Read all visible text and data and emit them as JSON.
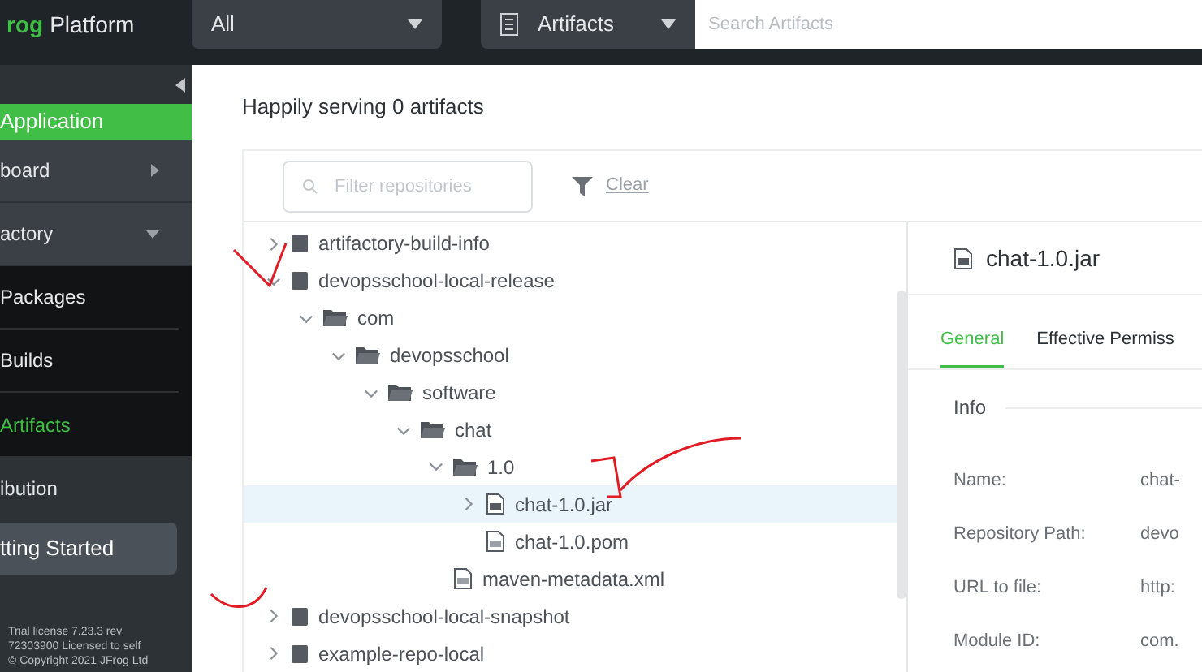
{
  "brand": {
    "logo": "rog",
    "name": "Platform"
  },
  "top_bar": {
    "scope_select": {
      "value": "All"
    },
    "type_select": {
      "value": "Artifacts"
    },
    "search": {
      "placeholder": "Search Artifacts"
    }
  },
  "sidebar": {
    "section": "Application",
    "items": [
      {
        "label": "board",
        "kind": "submenu",
        "expanded": false,
        "selected": false
      },
      {
        "label": "actory",
        "kind": "submenu",
        "expanded": true,
        "selected": false,
        "children": [
          {
            "label": "Packages",
            "selected": false
          },
          {
            "label": "Builds",
            "selected": false
          },
          {
            "label": "Artifacts",
            "selected": true
          }
        ]
      },
      {
        "label": "ibution",
        "kind": "plain",
        "expanded": false,
        "selected": false
      }
    ],
    "getting_started": "tting Started",
    "license": [
      "Trial license 7.23.3 rev",
      "72303900 Licensed to self",
      "© Copyright 2021 JFrog Ltd"
    ]
  },
  "heading": "Happily serving 0 artifacts",
  "filter": {
    "placeholder": "Filter repositories",
    "clear": "Clear"
  },
  "tree": [
    {
      "label": "artifactory-build-info",
      "kind": "repo",
      "expanded": false,
      "selected": false
    },
    {
      "label": "devopsschool-local-release",
      "kind": "repo",
      "expanded": true,
      "selected": false,
      "children": [
        {
          "label": "com",
          "kind": "folder",
          "expanded": true,
          "selected": false,
          "children": [
            {
              "label": "devopsschool",
              "kind": "folder",
              "expanded": true,
              "selected": false,
              "children": [
                {
                  "label": "software",
                  "kind": "folder",
                  "expanded": true,
                  "selected": false,
                  "children": [
                    {
                      "label": "chat",
                      "kind": "folder",
                      "expanded": true,
                      "selected": false,
                      "children": [
                        {
                          "label": "1.0",
                          "kind": "folder",
                          "expanded": true,
                          "selected": false,
                          "children": [
                            {
                              "label": "chat-1.0.jar",
                              "kind": "archive",
                              "expanded": false,
                              "selected": true
                            },
                            {
                              "label": "chat-1.0.pom",
                              "kind": "file",
                              "selected": false
                            }
                          ]
                        },
                        {
                          "label": "maven-metadata.xml",
                          "kind": "file",
                          "selected": false
                        }
                      ]
                    }
                  ]
                }
              ]
            }
          ]
        }
      ]
    },
    {
      "label": "devopsschool-local-snapshot",
      "kind": "repo",
      "expanded": false,
      "selected": false
    },
    {
      "label": "example-repo-local",
      "kind": "repo",
      "expanded": false,
      "selected": false
    }
  ],
  "details": {
    "title": "chat-1.0.jar",
    "tabs": [
      {
        "label": "General",
        "selected": true
      },
      {
        "label": "Effective Permiss",
        "selected": false
      }
    ],
    "section": "Info",
    "fields": [
      {
        "label": "Name:",
        "value": "chat-"
      },
      {
        "label": "Repository Path:",
        "value": "devo"
      },
      {
        "label": "URL to file:",
        "value": "http:"
      },
      {
        "label": "Module ID:",
        "value": "com."
      }
    ]
  }
}
